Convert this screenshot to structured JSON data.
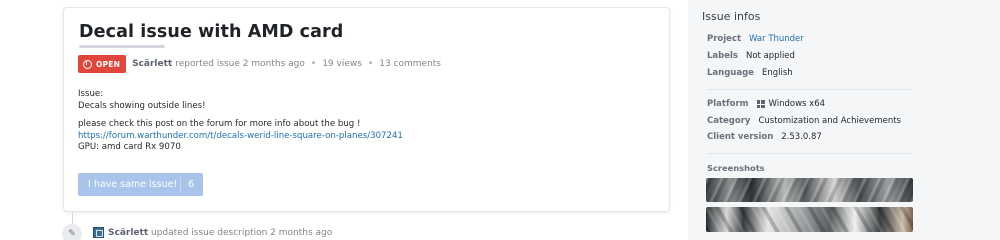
{
  "issue": {
    "title": "Decal issue with AMD card",
    "status": "OPEN",
    "author": "Scärlett",
    "reported_text": "reported issue 2 months ago",
    "views": "19 views",
    "comments": "13 comments",
    "body": {
      "line1": "Issue:",
      "line2": "Decals showing outside lines!",
      "line3": "please check this post on the forum for more info about the bug !",
      "link": "https://forum.warthunder.com/t/decals-werid-line-square-on-planes/307241",
      "line4": "GPU: amd card Rx 9070"
    },
    "same_issue_label": "I have same issue!",
    "same_issue_count": "6"
  },
  "timeline": {
    "author": "Scärlett",
    "action_text": "updated issue description 2 months ago",
    "icon": "pencil-icon"
  },
  "sidebar": {
    "heading": "Issue infos",
    "project_label": "Project",
    "project_value": "War Thunder",
    "labels_label": "Labels",
    "labels_value": "Not applied",
    "language_label": "Language",
    "language_value": "English",
    "platform_label": "Platform",
    "platform_value": "Windows x64",
    "platform_icon": "windows-icon",
    "category_label": "Category",
    "category_value": "Customization and Achievements",
    "client_label": "Client version",
    "client_value": "2.53.0.87",
    "screenshots_label": "Screenshots"
  },
  "colors": {
    "status_open": "#e0463b",
    "link": "#1f6fb5",
    "button_disabled": "#a9c4ea",
    "sidebar_bg": "#f5f6f8"
  }
}
